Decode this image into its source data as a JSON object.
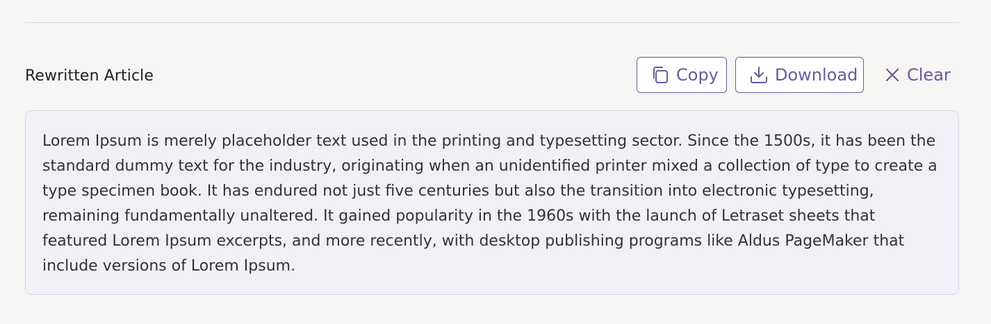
{
  "section": {
    "title": "Rewritten Article"
  },
  "toolbar": {
    "copy_label": "Copy",
    "download_label": "Download",
    "clear_label": "Clear"
  },
  "icons": {
    "copy": "copy-icon",
    "download": "download-icon",
    "clear": "close-icon"
  },
  "colors": {
    "accent": "#6a5a9e",
    "box_background": "#f2f0f6",
    "page_background": "#f6f5f3"
  },
  "article": {
    "text": "Lorem Ipsum is merely placeholder text used in the printing and typesetting sector. Since the 1500s, it has been the standard dummy text for the industry, originating when an unidentified printer mixed a collection of type to create a type specimen book. It has endured not just five centuries but also the transition into electronic typesetting, remaining fundamentally unaltered. It gained popularity in the 1960s with the launch of Letraset sheets that featured Lorem Ipsum excerpts, and more recently, with desktop publishing programs like Aldus PageMaker that include versions of Lorem Ipsum."
  }
}
